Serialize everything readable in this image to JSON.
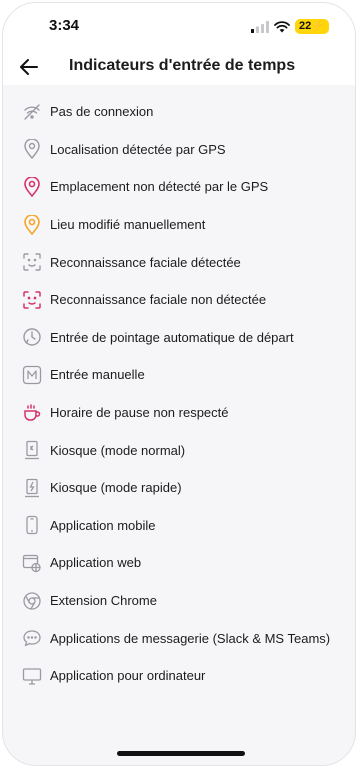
{
  "status": {
    "time": "3:34",
    "battery": "22"
  },
  "header": {
    "title": "Indicateurs d'entrée de temps"
  },
  "items": [
    {
      "label": "Pas de connexion",
      "icon": "no-signal-icon"
    },
    {
      "label": "Localisation détectée par GPS",
      "icon": "location-pin-icon"
    },
    {
      "label": "Emplacement non détecté par le GPS",
      "icon": "location-pin-red-icon"
    },
    {
      "label": "Lieu modifié manuellement",
      "icon": "location-pin-orange-icon"
    },
    {
      "label": "Reconnaissance faciale détectée",
      "icon": "face-scan-icon"
    },
    {
      "label": "Reconnaissance faciale non détectée",
      "icon": "face-scan-red-icon"
    },
    {
      "label": "Entrée de pointage automatique de départ",
      "icon": "auto-clock-icon"
    },
    {
      "label": "Entrée manuelle",
      "icon": "manual-m-icon"
    },
    {
      "label": "Horaire de pause non respecté",
      "icon": "coffee-cup-icon"
    },
    {
      "label": "Kiosque (mode normal)",
      "icon": "kiosk-normal-icon"
    },
    {
      "label": "Kiosque (mode rapide)",
      "icon": "kiosk-fast-icon"
    },
    {
      "label": "Application mobile",
      "icon": "mobile-phone-icon"
    },
    {
      "label": "Application web",
      "icon": "web-browser-icon"
    },
    {
      "label": "Extension Chrome",
      "icon": "chrome-icon"
    },
    {
      "label": "Applications de messagerie (Slack & MS Teams)",
      "icon": "chat-bubble-icon"
    },
    {
      "label": "Application pour ordinateur",
      "icon": "desktop-monitor-icon"
    }
  ],
  "colors": {
    "gray_icon": "#9a9aa2",
    "red_icon": "#d6336c",
    "orange_icon": "#f5a623"
  }
}
